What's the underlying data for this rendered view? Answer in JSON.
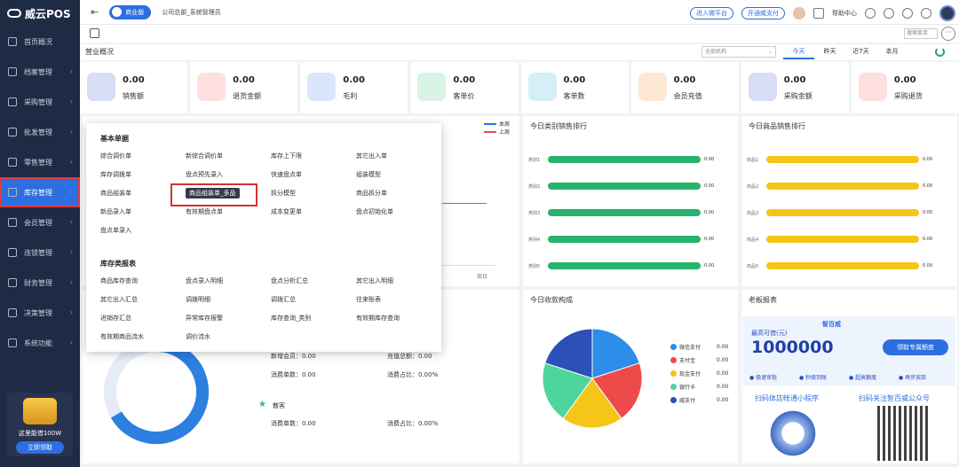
{
  "app": {
    "name": "威云POS"
  },
  "sidebar": {
    "items": [
      {
        "label": "首页概况",
        "icon": "home-icon"
      },
      {
        "label": "档案管理",
        "icon": "folder-icon"
      },
      {
        "label": "采购管理",
        "icon": "cart-icon"
      },
      {
        "label": "批发管理",
        "icon": "building-icon"
      },
      {
        "label": "零售管理",
        "icon": "bag-icon"
      },
      {
        "label": "库存管理",
        "icon": "inventory-icon"
      },
      {
        "label": "会员管理",
        "icon": "member-icon"
      },
      {
        "label": "连锁管理",
        "icon": "chain-icon"
      },
      {
        "label": "财务管理",
        "icon": "finance-icon"
      },
      {
        "label": "决策管理",
        "icon": "decision-icon"
      },
      {
        "label": "系统功能",
        "icon": "gear-icon"
      }
    ],
    "promo": {
      "text": "这里能借100W",
      "button": "立即领取"
    }
  },
  "topbar": {
    "edition": "商业版",
    "org": "公司总部_系统管理员",
    "btn_enter": "进入微平台",
    "btn_pay": "开通威支付",
    "help": "帮助中心"
  },
  "crumb": {
    "search_placeholder": "搜索菜单"
  },
  "overview": {
    "title": "营业概况",
    "org_select": "全部机构",
    "ranges": [
      "今天",
      "昨天",
      "近7天",
      "本月"
    ]
  },
  "kpis": [
    {
      "value": "0.00",
      "label": "销售额",
      "color": "#d8dcf5"
    },
    {
      "value": "0.00",
      "label": "退货金额",
      "color": "#fde0de"
    },
    {
      "value": "0.00",
      "label": "毛利",
      "color": "#d9e6fb"
    },
    {
      "value": "0.00",
      "label": "客单价",
      "color": "#d9f3e6"
    },
    {
      "value": "0.00",
      "label": "客单数",
      "color": "#d6eef8"
    },
    {
      "value": "0.00",
      "label": "会员充值",
      "color": "#fde9d3"
    },
    {
      "value": "0.00",
      "label": "采购金额",
      "color": "#d8dcf5"
    },
    {
      "value": "0.00",
      "label": "采购退货",
      "color": "#fde0de"
    }
  ],
  "sales_trend": {
    "legend_this": "本周",
    "legend_last": "上周",
    "x_last_label": "周日"
  },
  "category_rank": {
    "title": "今日类别销售排行",
    "rows": [
      {
        "label": "类别1",
        "value": "0.00"
      },
      {
        "label": "类别2",
        "value": "0.00"
      },
      {
        "label": "类别3",
        "value": "0.00"
      },
      {
        "label": "类别4",
        "value": "0.00"
      },
      {
        "label": "类别5",
        "value": "0.00"
      }
    ]
  },
  "product_rank": {
    "title": "今日商品销售排行",
    "rows": [
      {
        "label": "商品1",
        "value": "0.00"
      },
      {
        "label": "商品2",
        "value": "0.00"
      },
      {
        "label": "商品3",
        "value": "0.00"
      },
      {
        "label": "商品4",
        "value": "0.00"
      },
      {
        "label": "商品5",
        "value": "0.00"
      }
    ]
  },
  "dropdown": {
    "sec1": "基本单据",
    "items1": [
      "综合调价单",
      "新综合调价单",
      "库存上下限",
      "其它出入单",
      "库存调拨单",
      "盘点预先录入",
      "快速盘点单",
      "组装模型",
      "商品组装单",
      "商品组装单_多品",
      "拆分模型",
      "商品拆分单",
      "新品录入单",
      "有效期盘点单",
      "成本变更单",
      "盘点初始化单",
      "盘点单录入"
    ],
    "sec2": "库存类报表",
    "items2": [
      "商品库存查询",
      "盘点录入明细",
      "盘点分析汇总",
      "其它出入明细",
      "其它出入汇总",
      "调拨明细",
      "调拨汇总",
      "往来账表",
      "进销存汇总",
      "异常库存报警",
      "库存查询_类别",
      "有效期库存查询",
      "有效期商品流水",
      "调价流水"
    ]
  },
  "member_stats": {
    "new_members": "新增会员：0.00",
    "recharge_total": "充值总额：0.00",
    "consume_count": "消费单数：0.00",
    "consume_ratio": "消费占比：0.00%",
    "walkin": "散客",
    "walkin_count": "消费单数：0.00",
    "walkin_ratio": "消费占比：0.00%"
  },
  "payment": {
    "title": "今日收款构成",
    "chart_data": {
      "type": "pie",
      "title": "今日收款构成",
      "categories": [
        "微信支付",
        "支付宝",
        "现金支付",
        "银行卡",
        "威支付"
      ],
      "values": [
        0.0,
        0.0,
        0.0,
        0.0,
        0.0
      ],
      "value_labels": [
        "0.00",
        "0.00",
        "0.00",
        "0.00",
        "0.00"
      ],
      "colors": [
        "#2c8ee8",
        "#ef4a4a",
        "#f5c518",
        "#4cd69c",
        "#2d4fb8"
      ],
      "legend": "right"
    }
  },
  "boss": {
    "title": "老板报表",
    "brand": "智百威",
    "limit_label": "最高可借(元)",
    "amount": "1000000",
    "cta": "领取专属额度",
    "features": [
      "极速审批",
      "秒级到账",
      "超高额度",
      "再步放款"
    ],
    "qr1": "扫码体店帐通小程序",
    "qr2": "扫码关注智百威公众号"
  }
}
